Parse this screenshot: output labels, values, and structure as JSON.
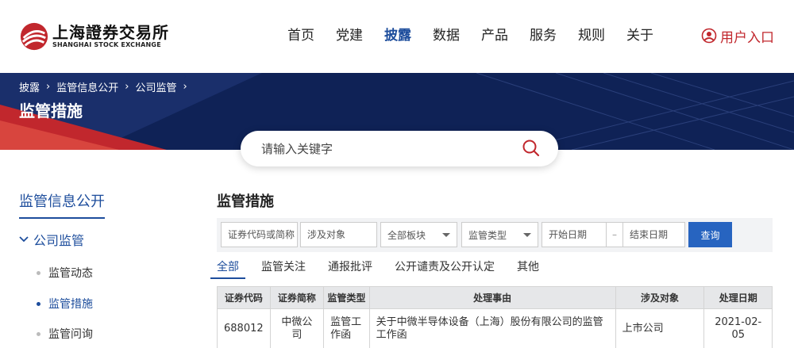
{
  "logo": {
    "cn": "上海證券交易所",
    "en": "SHANGHAI STOCK EXCHANGE",
    "brand_color": "#c1272d"
  },
  "nav": {
    "items": [
      {
        "label": "首页"
      },
      {
        "label": "党建"
      },
      {
        "label": "披露"
      },
      {
        "label": "数据"
      },
      {
        "label": "产品"
      },
      {
        "label": "服务"
      },
      {
        "label": "规则"
      },
      {
        "label": "关于"
      }
    ],
    "active": "披露",
    "user_label": "用户入口"
  },
  "breadcrumb": [
    "披露",
    "监管信息公开",
    "公司监管"
  ],
  "banner_title": "监管措施",
  "search": {
    "placeholder": "请输入关键字"
  },
  "sidebar": {
    "title": "监管信息公开",
    "group": "公司监管",
    "items": [
      {
        "label": "监管动态",
        "active": false
      },
      {
        "label": "监管措施",
        "active": true
      },
      {
        "label": "监管问询",
        "active": false
      }
    ]
  },
  "main": {
    "title": "监管措施",
    "filters": {
      "code_placeholder": "证券代码或简称",
      "target_placeholder": "涉及对象",
      "board_select": "全部板块",
      "type_select": "监管类型",
      "start_placeholder": "开始日期",
      "date_sep": "–",
      "end_placeholder": "结束日期",
      "query_label": "查询"
    },
    "tabs": [
      {
        "label": "全部",
        "active": true
      },
      {
        "label": "监管关注"
      },
      {
        "label": "通报批评"
      },
      {
        "label": "公开谴责及公开认定"
      },
      {
        "label": "其他"
      }
    ],
    "table": {
      "headers": [
        "证券代码",
        "证券简称",
        "监管类型",
        "处理事由",
        "涉及对象",
        "处理日期"
      ],
      "rows": [
        [
          "688012",
          "中微公司",
          "监管工作函",
          "关于中微半导体设备（上海）股份有限公司的监管工作函",
          "上市公司",
          "2021-02-05"
        ]
      ]
    }
  },
  "colors": {
    "accent": "#1d4d9c",
    "banner": "#0f2256",
    "button": "#2764c0"
  }
}
